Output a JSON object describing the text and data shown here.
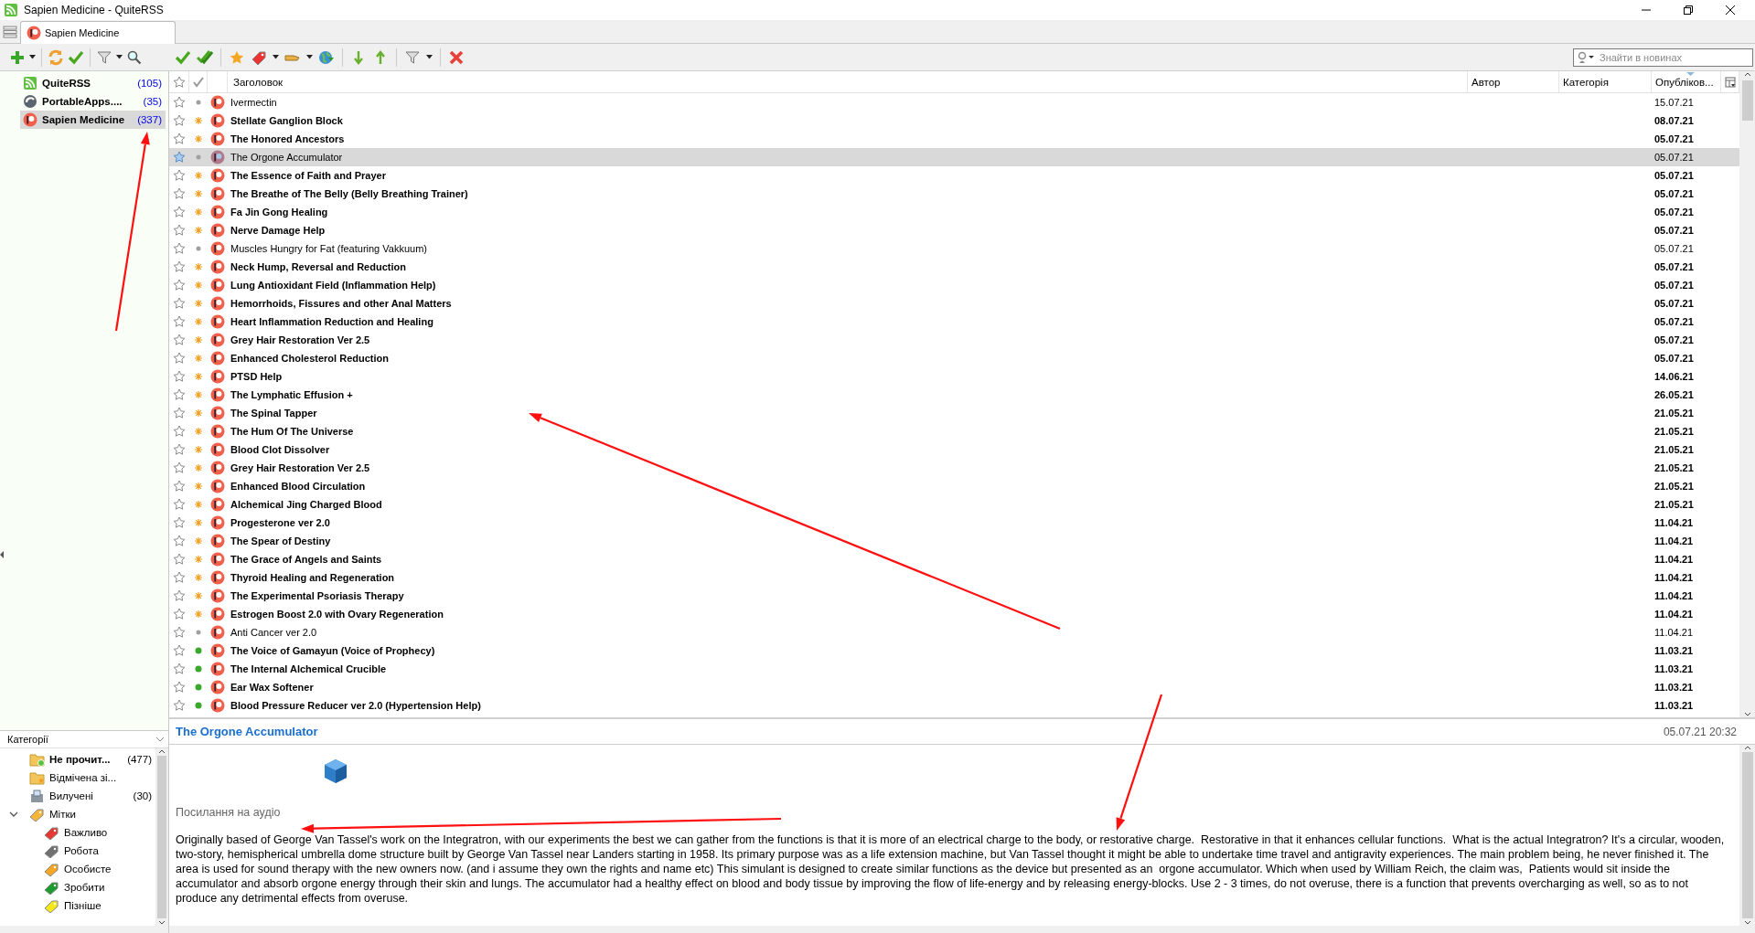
{
  "window": {
    "title": "Sapien Medicine - QuiteRSS"
  },
  "tabs": [
    {
      "label": "Sapien Medicine",
      "selected": true
    }
  ],
  "search": {
    "placeholder": "Знайти в новинах"
  },
  "feeds": [
    {
      "name": "QuiteRSS",
      "count": "(105)",
      "kind": "rss",
      "selected": false
    },
    {
      "name": "PortableApps....",
      "count": "(35)",
      "kind": "disc",
      "selected": false
    },
    {
      "name": "Sapien Medicine",
      "count": "(337)",
      "kind": "patron",
      "selected": true
    }
  ],
  "categories": {
    "title": "Категорії",
    "items": [
      {
        "name": "Не прочит...",
        "count": "(477)",
        "kind": "unread"
      },
      {
        "name": "Відмічена зі...",
        "kind": "starred"
      },
      {
        "name": "Вилучені",
        "count": "(30)",
        "kind": "deleted"
      },
      {
        "name": "Мітки",
        "kind": "labels",
        "expanded": true,
        "children": [
          {
            "name": "Важливо",
            "color": "#e53935"
          },
          {
            "name": "Робота",
            "color": "#707070"
          },
          {
            "name": "Особисте",
            "color": "#f5a623"
          },
          {
            "name": "Зробити",
            "color": "#1e9b2e"
          },
          {
            "name": "Пізніше",
            "color": "#f4e81a"
          }
        ]
      }
    ]
  },
  "columns": [
    {
      "label": "Заголовок",
      "sorted": false
    },
    {
      "label": "Автор",
      "sorted": false
    },
    {
      "label": "Категорія",
      "sorted": false
    },
    {
      "label": "Опубліков...",
      "sorted": true
    }
  ],
  "rows": [
    {
      "title": "Ivermectin",
      "date": "15.07.21",
      "kind": "read",
      "starred": false,
      "selected": false
    },
    {
      "title": "Stellate Ganglion Block",
      "date": "08.07.21",
      "kind": "new",
      "starred": false,
      "selected": false
    },
    {
      "title": "The Honored Ancestors",
      "date": "05.07.21",
      "kind": "new",
      "starred": false,
      "selected": false
    },
    {
      "title": "The Orgone Accumulator",
      "date": "05.07.21",
      "kind": "read",
      "starred": false,
      "selected": true
    },
    {
      "title": "The Essence of Faith and Prayer",
      "date": "05.07.21",
      "kind": "new",
      "starred": false,
      "selected": false
    },
    {
      "title": "The Breathe of The Belly (Belly Breathing Trainer)",
      "date": "05.07.21",
      "kind": "new",
      "starred": false,
      "selected": false
    },
    {
      "title": "Fa Jin Gong Healing",
      "date": "05.07.21",
      "kind": "new",
      "starred": false,
      "selected": false
    },
    {
      "title": "Nerve Damage Help",
      "date": "05.07.21",
      "kind": "new",
      "starred": false,
      "selected": false
    },
    {
      "title": "Muscles Hungry for Fat (featuring Vakkuum)",
      "date": "05.07.21",
      "kind": "read",
      "starred": false,
      "selected": false
    },
    {
      "title": "Neck Hump, Reversal and Reduction",
      "date": "05.07.21",
      "kind": "new",
      "starred": false,
      "selected": false
    },
    {
      "title": "Lung Antioxidant Field (Inflammation Help)",
      "date": "05.07.21",
      "kind": "new",
      "starred": false,
      "selected": false
    },
    {
      "title": "Hemorrhoids, Fissures and other Anal Matters",
      "date": "05.07.21",
      "kind": "new",
      "starred": false,
      "selected": false
    },
    {
      "title": "Heart Inflammation Reduction and Healing",
      "date": "05.07.21",
      "kind": "new",
      "starred": false,
      "selected": false
    },
    {
      "title": "Grey Hair Restoration Ver 2.5",
      "date": "05.07.21",
      "kind": "new",
      "starred": false,
      "selected": false
    },
    {
      "title": "Enhanced Cholesterol Reduction",
      "date": "05.07.21",
      "kind": "new",
      "starred": false,
      "selected": false
    },
    {
      "title": "PTSD Help",
      "date": "14.06.21",
      "kind": "new",
      "starred": false,
      "selected": false
    },
    {
      "title": "The Lymphatic Effusion +",
      "date": "26.05.21",
      "kind": "new",
      "starred": false,
      "selected": false
    },
    {
      "title": "The Spinal Tapper",
      "date": "21.05.21",
      "kind": "new",
      "starred": false,
      "selected": false
    },
    {
      "title": "The Hum Of The Universe",
      "date": "21.05.21",
      "kind": "new",
      "starred": false,
      "selected": false
    },
    {
      "title": "Blood Clot Dissolver",
      "date": "21.05.21",
      "kind": "new",
      "starred": false,
      "selected": false
    },
    {
      "title": "Grey Hair Restoration Ver 2.5",
      "date": "21.05.21",
      "kind": "new",
      "starred": false,
      "selected": false
    },
    {
      "title": "Enhanced Blood Circulation",
      "date": "21.05.21",
      "kind": "new",
      "starred": false,
      "selected": false
    },
    {
      "title": "Alchemical Jing Charged Blood",
      "date": "21.05.21",
      "kind": "new",
      "starred": false,
      "selected": false
    },
    {
      "title": "Progesterone ver 2.0",
      "date": "11.04.21",
      "kind": "new",
      "starred": false,
      "selected": false
    },
    {
      "title": "The Spear of Destiny",
      "date": "11.04.21",
      "kind": "new",
      "starred": false,
      "selected": false
    },
    {
      "title": "The Grace of Angels and Saints",
      "date": "11.04.21",
      "kind": "new",
      "starred": false,
      "selected": false
    },
    {
      "title": "Thyroid Healing and Regeneration",
      "date": "11.04.21",
      "kind": "new",
      "starred": false,
      "selected": false
    },
    {
      "title": "The Experimental Psoriasis Therapy",
      "date": "11.04.21",
      "kind": "new",
      "starred": false,
      "selected": false
    },
    {
      "title": "Estrogen Boost 2.0 with Ovary Regeneration",
      "date": "11.04.21",
      "kind": "new",
      "starred": false,
      "selected": false
    },
    {
      "title": "Anti Cancer ver 2.0",
      "date": "11.04.21",
      "kind": "read",
      "starred": false,
      "selected": false
    },
    {
      "title": "The Voice of Gamayun (Voice of Prophecy)",
      "date": "11.03.21",
      "kind": "unread",
      "starred": false,
      "selected": false
    },
    {
      "title": "The Internal Alchemical Crucible",
      "date": "11.03.21",
      "kind": "unread",
      "starred": false,
      "selected": false
    },
    {
      "title": "Ear Wax Softener",
      "date": "11.03.21",
      "kind": "unread",
      "starred": false,
      "selected": false
    },
    {
      "title": "Blood Pressure Reducer ver 2.0 (Hypertension Help)",
      "date": "11.03.21",
      "kind": "unread",
      "starred": false,
      "selected": false
    }
  ],
  "preview": {
    "title": "The Orgone Accumulator",
    "date": "05.07.21 20:32",
    "link": "Посилання на аудіо",
    "body": "Originally based of George Van Tassel's work on the Integratron, with our experiments the best we can gather from the functions is that it is more of an electrical charge to the body, or restorative charge.  Restorative in that it enhances cellular functions.  What is the actual Integratron? It's a circular, wooden, two-story, hemispherical umbrella dome structure built by George Van Tassel near Landers starting in 1958. Its primary purpose was as a life extension machine, but Van Tassel thought it might be able to undertake time travel and antigravity experiences. The main problem being, he never finished it. The area is used for sound therapy with the new owners now. (and i assume they own the rights and name etc) This simulant is designed to create similar functions as the device but presented as an  orgone accumulator. Which when used by William Reich, the claim was,  Patients would sit inside the accumulator and absorb orgone energy through their skin and lungs. The accumulator had a healthy effect on blood and body tissue by improving the flow of life-energy and by releasing energy-blocks. Use 2 - 3 times, do not overuse, there is a function that prevents overcharging as well, so as to not produce any detrimental effects from overuse."
  }
}
